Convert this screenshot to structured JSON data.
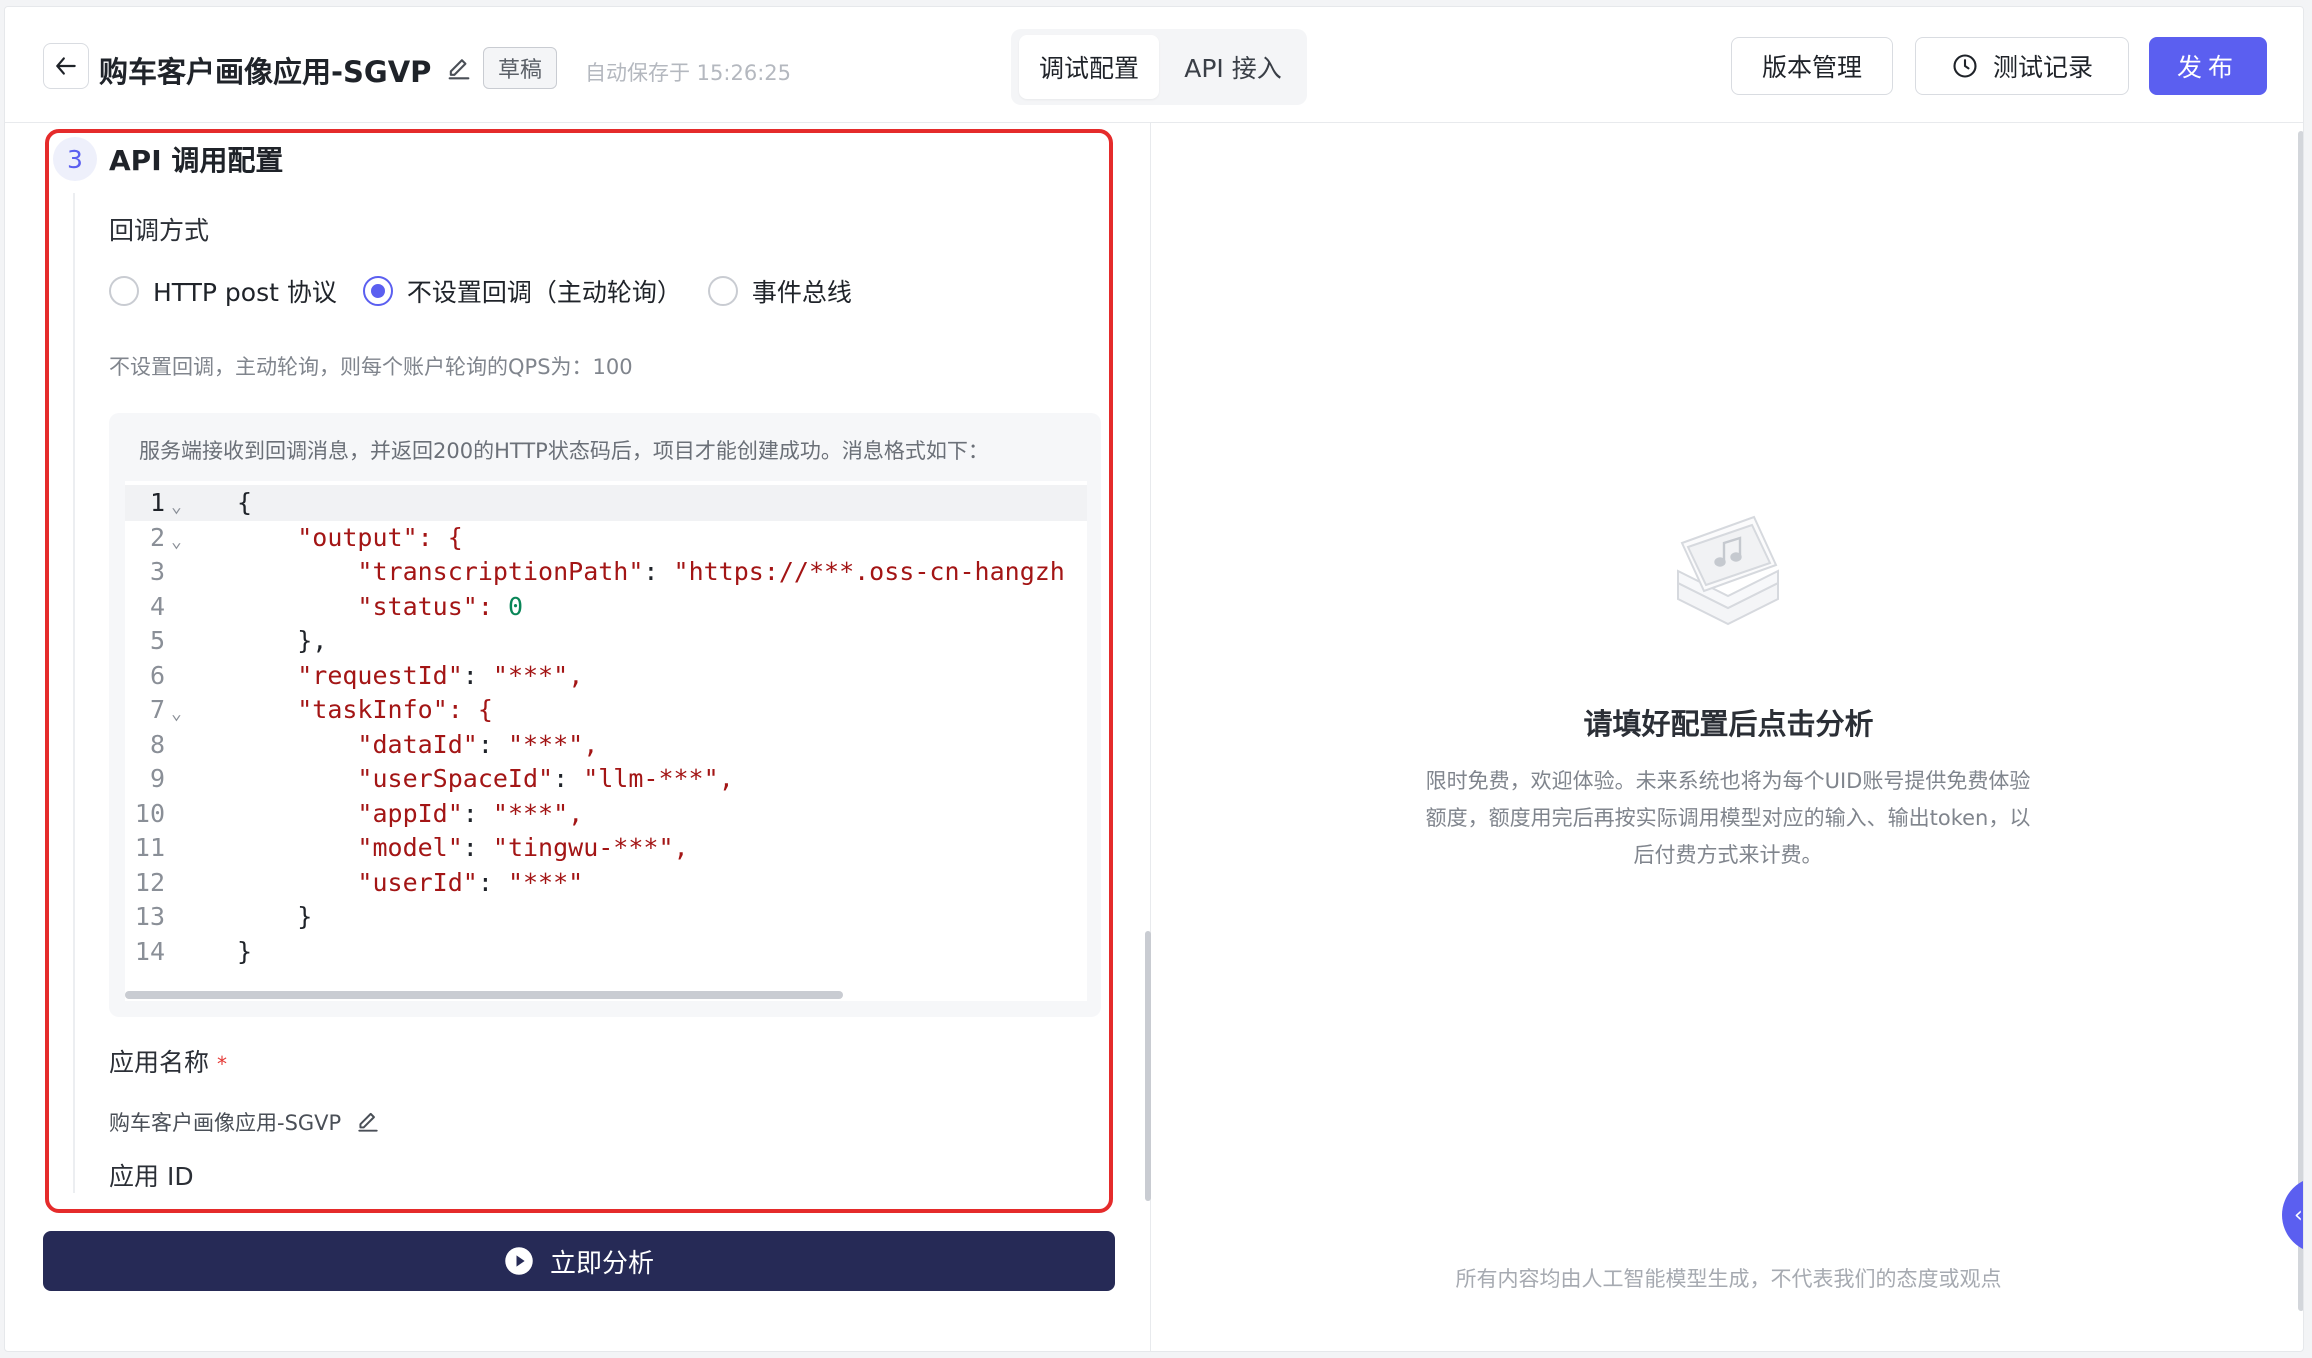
{
  "header": {
    "title": "购车客户画像应用-SGVP",
    "badge": "草稿",
    "autosave": "自动保存于 15:26:25",
    "tabs": [
      {
        "label": "调试配置",
        "active": true
      },
      {
        "label": "API 接入",
        "active": false
      }
    ],
    "version_label": "版本管理",
    "test_label": "测试记录",
    "publish_label": "发布"
  },
  "section": {
    "number": "3",
    "title": "API 调用配置",
    "callback_label": "回调方式",
    "radios": [
      {
        "label": "HTTP post 协议",
        "checked": false
      },
      {
        "label": "不设置回调（主动轮询）",
        "checked": true
      },
      {
        "label": "事件总线",
        "checked": false
      }
    ],
    "hint": "不设置回调，主动轮询，则每个账户轮询的QPS为：100",
    "code_note": "服务端接收到回调消息，并返回200的HTTP状态码后，项目才能创建成功。消息格式如下：",
    "code_lines": [
      {
        "n": "1",
        "fold": true,
        "text": "{"
      },
      {
        "n": "2",
        "fold": true,
        "text": "    \"output\": {"
      },
      {
        "n": "3",
        "fold": false,
        "text": "        \"transcriptionPath\": \"https://***.oss-cn-hangzh"
      },
      {
        "n": "4",
        "fold": false,
        "text": "        \"status\": 0"
      },
      {
        "n": "5",
        "fold": false,
        "text": "    },"
      },
      {
        "n": "6",
        "fold": false,
        "text": "    \"requestId\": \"***\","
      },
      {
        "n": "7",
        "fold": true,
        "text": "    \"taskInfo\": {"
      },
      {
        "n": "8",
        "fold": false,
        "text": "        \"dataId\": \"***\","
      },
      {
        "n": "9",
        "fold": false,
        "text": "        \"userSpaceId\": \"llm-***\","
      },
      {
        "n": "10",
        "fold": false,
        "text": "        \"appId\": \"***\","
      },
      {
        "n": "11",
        "fold": false,
        "text": "        \"model\": \"tingwu-***\","
      },
      {
        "n": "12",
        "fold": false,
        "text": "        \"userId\": \"***\""
      },
      {
        "n": "13",
        "fold": false,
        "text": "    }"
      },
      {
        "n": "14",
        "fold": false,
        "text": "}"
      }
    ],
    "name_label": "应用名称",
    "required_mark": "*",
    "name_value": "购车客户画像应用-SGVP",
    "id_label": "应用 ID"
  },
  "analyze_label": "立即分析",
  "empty": {
    "title": "请填好配置后点击分析",
    "description": "限时免费，欢迎体验。未来系统也将为每个UID账号提供免费体验额度，额度用完后再按实际调用模型对应的输入、输出token，以后付费方式来计费。"
  },
  "disclaimer": "所有内容均由人工智能模型生成，不代表我们的态度或观点",
  "colors": {
    "accent": "#5b5ff0",
    "analyze_bg": "#262a56",
    "highlight_border": "#e52b2b"
  }
}
